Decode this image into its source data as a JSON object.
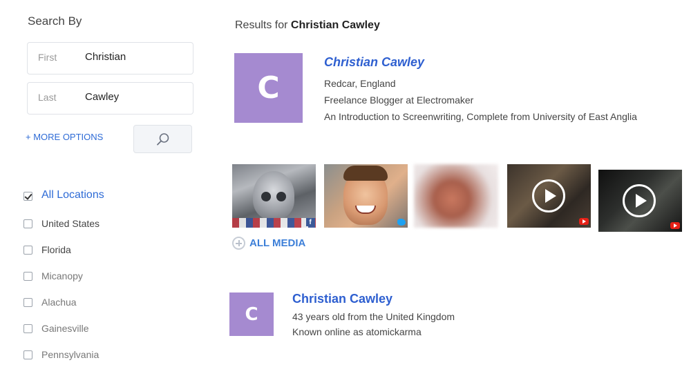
{
  "sidebar": {
    "title": "Search By",
    "first": {
      "label": "First",
      "value": "Christian"
    },
    "last": {
      "label": "Last",
      "value": "Cawley"
    },
    "more_options": "+ MORE OPTIONS",
    "search_button_icon": "search-icon",
    "locations": [
      {
        "label": "All Locations",
        "checked": true
      },
      {
        "label": "United States",
        "checked": false
      },
      {
        "label": "Florida",
        "checked": false
      },
      {
        "label": "Micanopy",
        "checked": false
      },
      {
        "label": "Alachua",
        "checked": false
      },
      {
        "label": "Gainesville",
        "checked": false
      },
      {
        "label": "Pennsylvania",
        "checked": false
      }
    ]
  },
  "main": {
    "results_prefix": "Results for",
    "query": "Christian Cawley",
    "results": [
      {
        "avatar_letter": "C",
        "name": "Christian Cawley",
        "location": "Redcar, England",
        "job": "Freelance Blogger at Electromaker",
        "education": "An Introduction to Screenwriting, Complete from University of East Anglia"
      },
      {
        "avatar_letter": "C",
        "name": "Christian Cawley",
        "age_line": "43 years old from the United Kingdom",
        "known_as": "Known online as atomickarma"
      }
    ],
    "media": [
      {
        "kind": "photo",
        "source": "facebook"
      },
      {
        "kind": "photo",
        "source": "twitter"
      },
      {
        "kind": "photo",
        "source": "blurred"
      },
      {
        "kind": "video",
        "source": "youtube"
      },
      {
        "kind": "video",
        "source": "youtube"
      }
    ],
    "all_media": "ALL MEDIA"
  },
  "colors": {
    "link": "#2e5fd0",
    "accent": "#3d7fd8",
    "avatar": "#a58ad0"
  }
}
